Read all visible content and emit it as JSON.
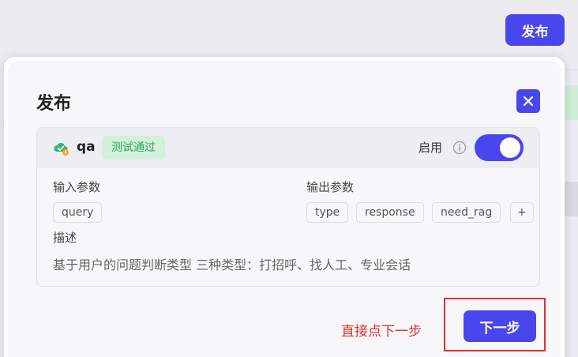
{
  "topbar": {
    "publish_label": "发布"
  },
  "modal": {
    "title": "发布",
    "close_icon": "close-icon",
    "plugin": {
      "name": "qa",
      "status": "测试通过",
      "icon": "cloud-check-icon",
      "enable_label": "启用",
      "enabled": true
    },
    "inputs": {
      "label": "输入参数",
      "tags": [
        "query"
      ]
    },
    "outputs": {
      "label": "输出参数",
      "tags": [
        "type",
        "response",
        "need_rag",
        "+"
      ]
    },
    "description": {
      "label": "描述",
      "text": "基于用户的问题判断类型 三种类型：打招呼、找人工、专业会话"
    },
    "next_label": "下一步"
  },
  "annotation": {
    "text": "直接点下一步",
    "color": "#e0302b"
  },
  "colors": {
    "accent": "#4a46ee",
    "success_bg": "#d3f0dc",
    "success_text": "#2ea85a"
  }
}
